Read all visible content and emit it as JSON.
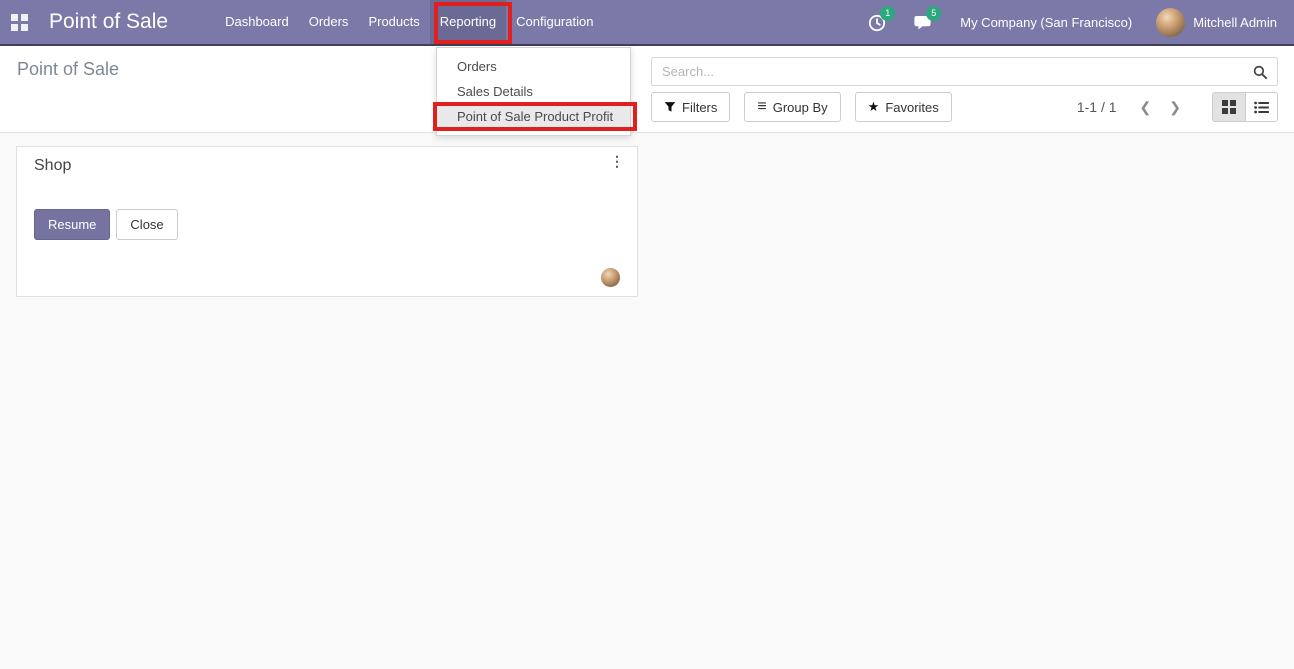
{
  "navbar": {
    "app_title": "Point of Sale",
    "menu": [
      "Dashboard",
      "Orders",
      "Products",
      "Reporting",
      "Configuration"
    ],
    "activity_badge": "1",
    "message_badge": "5",
    "company": "My Company (San Francisco)",
    "user": "Mitchell Admin"
  },
  "reporting_dropdown": {
    "items": [
      "Orders",
      "Sales Details",
      "Point of Sale Product Profit"
    ]
  },
  "control_panel": {
    "breadcrumb": "Point of Sale",
    "search": {
      "placeholder": "Search..."
    },
    "filters": "Filters",
    "group_by": "Group By",
    "favorites": "Favorites",
    "pager": "1-1 / 1"
  },
  "kanban": {
    "shop_card": {
      "title": "Shop",
      "resume": "Resume",
      "close": "Close"
    }
  },
  "icons": {
    "star": "★",
    "hamburger": "≡",
    "chevron_left": "❮",
    "chevron_right": "❯",
    "kebab": "⋮"
  },
  "colors": {
    "navbar_bg": "#7a79a8",
    "navbar_active_bg": "#6b6a94",
    "primary_button": "#7574a0",
    "badge_green": "#2ba87e",
    "annotation_red": "#e01f1f"
  }
}
